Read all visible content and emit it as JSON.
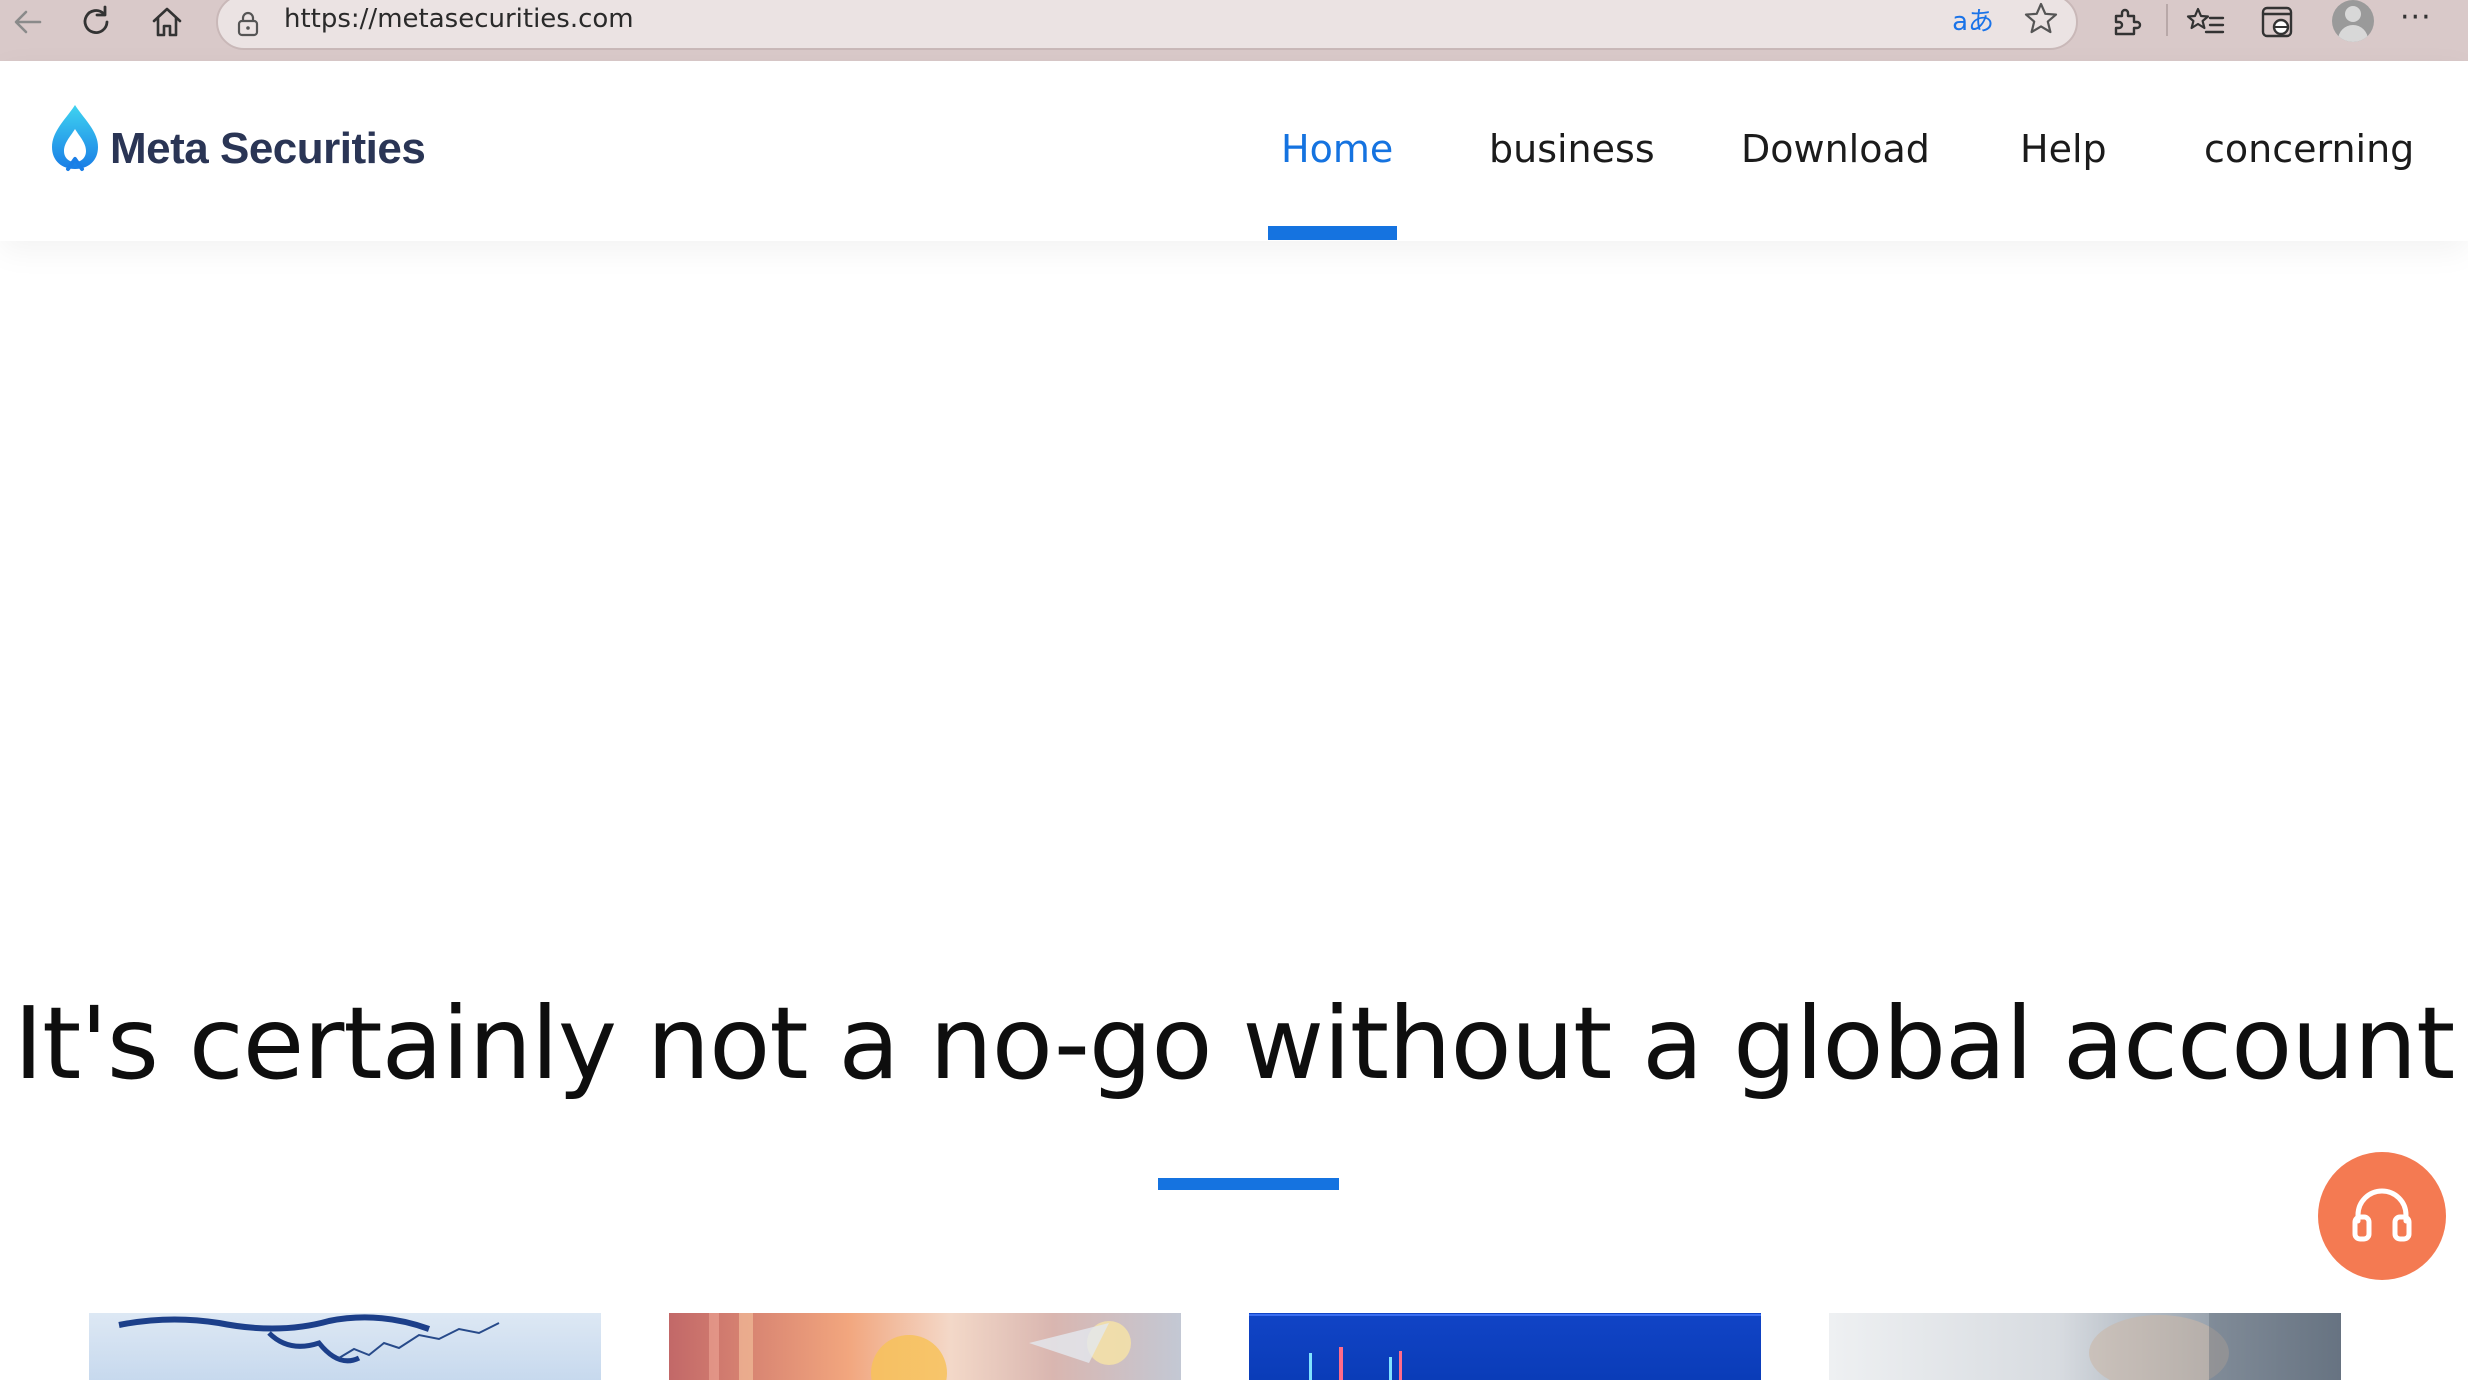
{
  "browser": {
    "url": "https://metasecurities.com",
    "translate_glyph": "aあ",
    "more_glyph": "···"
  },
  "header": {
    "logo_text": "Meta Securities",
    "nav": [
      {
        "label": "Home",
        "active": true
      },
      {
        "label": "business",
        "active": false
      },
      {
        "label": "Download",
        "active": false
      },
      {
        "label": "Help",
        "active": false
      },
      {
        "label": "concerning",
        "active": false
      }
    ]
  },
  "hero": {
    "title": "It's certainly not a no-go without a global account"
  },
  "colors": {
    "accent": "#1573e0",
    "service_button": "#f47a52",
    "browser_bar": "#d9c9c9"
  },
  "icons": {
    "customer_service": "headset-icon"
  }
}
